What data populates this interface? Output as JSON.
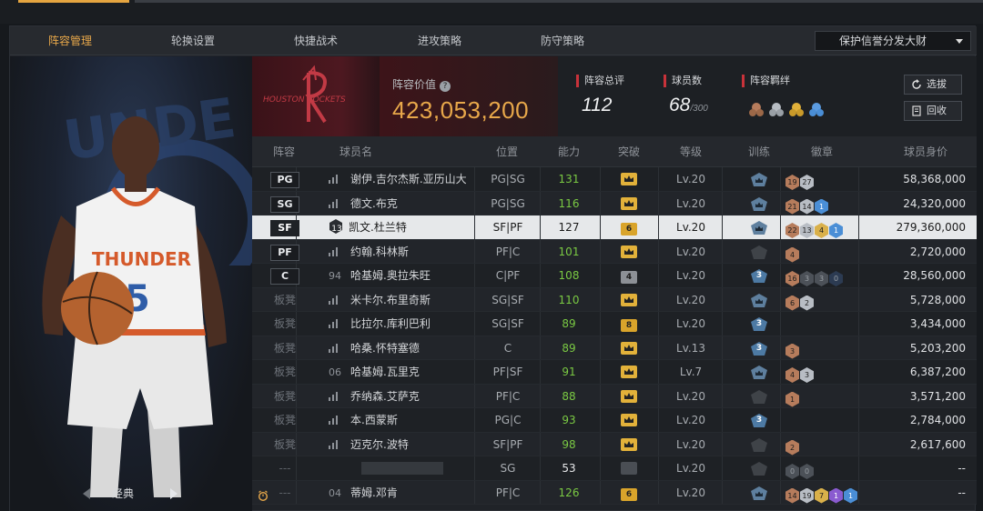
{
  "nav": {
    "tabs": [
      "阵容管理",
      "轮换设置",
      "快捷战术",
      "进攻策略",
      "防守策略"
    ],
    "active_tab": 0,
    "strategy_select": "保护信誉分发大财"
  },
  "left_panel": {
    "classic_label": "经典"
  },
  "team": {
    "logo_text": "HOUSTON ROCKETS",
    "value_label": "阵容价值",
    "value": "423,053,200",
    "rating_label": "阵容总评",
    "rating": "112",
    "players_label": "球员数",
    "players": "68",
    "players_max": "/300",
    "bond_label": "阵容羁绊",
    "select_button": "选拔",
    "recycle_button": "回收",
    "accent_color": "#e8a84a",
    "brand_red": "#c8323a"
  },
  "table": {
    "headers": [
      "阵容",
      "球员名",
      "位置",
      "能力",
      "突破",
      "等级",
      "训练",
      "徽章",
      "球员身价"
    ],
    "rows": [
      {
        "lineup": "PG",
        "lineup_type": "starter",
        "num": "",
        "name": "谢伊.吉尔杰斯.亚历山大",
        "position": "PG|SG",
        "ability": "131",
        "ability_color": "green",
        "breakthrough": "crown",
        "level": "Lv.20",
        "training": "silver",
        "badges": [
          [
            "b-bronze",
            "19"
          ],
          [
            "b-silver",
            "27"
          ]
        ],
        "salary": "58,368,000"
      },
      {
        "lineup": "SG",
        "lineup_type": "starter",
        "num": "",
        "name": "德文.布克",
        "position": "PG|SG",
        "ability": "116",
        "ability_color": "green",
        "breakthrough": "crown",
        "level": "Lv.20",
        "training": "silver",
        "badges": [
          [
            "b-bronze",
            "21"
          ],
          [
            "b-silver",
            "14"
          ],
          [
            "b-blue",
            "1"
          ]
        ],
        "salary": "24,320,000"
      },
      {
        "lineup": "SF",
        "lineup_type": "starter",
        "num": "13",
        "name": "凯文.杜兰特",
        "position": "SF|PF",
        "ability": "127",
        "ability_color": "white",
        "breakthrough": "6",
        "level": "Lv.20",
        "training": "silver",
        "badges": [
          [
            "b-bronze",
            "22"
          ],
          [
            "b-silver",
            "13"
          ],
          [
            "b-gold",
            "4"
          ],
          [
            "b-blue",
            "1"
          ]
        ],
        "salary": "279,360,000",
        "selected": true
      },
      {
        "lineup": "PF",
        "lineup_type": "starter",
        "num": "",
        "name": "约翰.科林斯",
        "position": "PF|C",
        "ability": "101",
        "ability_color": "green",
        "breakthrough": "crown",
        "level": "Lv.20",
        "training": "dark",
        "badges": [
          [
            "b-bronze",
            "4"
          ]
        ],
        "salary": "2,720,000"
      },
      {
        "lineup": "C",
        "lineup_type": "starter",
        "num": "94",
        "name": "哈基姆.奥拉朱旺",
        "position": "C|PF",
        "ability": "108",
        "ability_color": "green",
        "breakthrough": "4",
        "level": "Lv.20",
        "training": "3",
        "badges": [
          [
            "b-bronze",
            "16"
          ],
          [
            "b-dark",
            "3"
          ],
          [
            "b-dark",
            "3"
          ],
          [
            "b-darkblue",
            "0"
          ]
        ],
        "salary": "28,560,000"
      },
      {
        "lineup": "板凳",
        "lineup_type": "bench",
        "num": "",
        "name": "米卡尔.布里奇斯",
        "position": "SG|SF",
        "ability": "110",
        "ability_color": "green",
        "breakthrough": "crown",
        "level": "Lv.20",
        "training": "silver",
        "badges": [
          [
            "b-bronze",
            "6"
          ],
          [
            "b-silver",
            "2"
          ]
        ],
        "salary": "5,728,000"
      },
      {
        "lineup": "板凳",
        "lineup_type": "bench",
        "num": "",
        "name": "比拉尔.库利巴利",
        "position": "SG|SF",
        "ability": "89",
        "ability_color": "green",
        "breakthrough": "8",
        "level": "Lv.20",
        "training": "3",
        "badges": [],
        "salary": "3,434,000"
      },
      {
        "lineup": "板凳",
        "lineup_type": "bench",
        "num": "",
        "name": "哈桑.怀特塞德",
        "position": "C",
        "ability": "89",
        "ability_color": "green",
        "breakthrough": "crown",
        "level": "Lv.13",
        "training": "3",
        "badges": [
          [
            "b-bronze",
            "3"
          ]
        ],
        "salary": "5,203,200"
      },
      {
        "lineup": "板凳",
        "lineup_type": "bench",
        "num": "06",
        "name": "哈基姆.瓦里克",
        "position": "PF|SF",
        "ability": "91",
        "ability_color": "green",
        "breakthrough": "crown",
        "level": "Lv.7",
        "training": "silver",
        "badges": [
          [
            "b-bronze",
            "4"
          ],
          [
            "b-silver",
            "3"
          ]
        ],
        "salary": "6,387,200"
      },
      {
        "lineup": "板凳",
        "lineup_type": "bench",
        "num": "",
        "name": "乔纳森.艾萨克",
        "position": "PF|C",
        "ability": "88",
        "ability_color": "green",
        "breakthrough": "crown",
        "level": "Lv.20",
        "training": "dark",
        "badges": [
          [
            "b-bronze",
            "1"
          ]
        ],
        "salary": "3,571,200"
      },
      {
        "lineup": "板凳",
        "lineup_type": "bench",
        "num": "",
        "name": "本.西蒙斯",
        "position": "PG|C",
        "ability": "93",
        "ability_color": "green",
        "breakthrough": "crown",
        "level": "Lv.20",
        "training": "3",
        "badges": [],
        "salary": "2,784,000"
      },
      {
        "lineup": "板凳",
        "lineup_type": "bench",
        "num": "",
        "name": "迈克尔.波特",
        "position": "SF|PF",
        "ability": "98",
        "ability_color": "green",
        "breakthrough": "crown",
        "level": "Lv.20",
        "training": "dark",
        "badges": [
          [
            "b-bronze",
            "2"
          ]
        ],
        "salary": "2,617,600"
      },
      {
        "lineup": "---",
        "lineup_type": "none",
        "num": "",
        "name": "",
        "position": "SG",
        "ability": "53",
        "ability_color": "white",
        "breakthrough": "dark",
        "level": "Lv.20",
        "training": "dark",
        "badges": [
          [
            "b-dark",
            "0"
          ],
          [
            "b-dark",
            "0"
          ]
        ],
        "salary": "--"
      },
      {
        "lineup": "---",
        "lineup_type": "none",
        "num": "04",
        "name": "蒂姆.邓肯",
        "position": "PF|C",
        "ability": "126",
        "ability_color": "green",
        "breakthrough": "6",
        "level": "Lv.20",
        "training": "silver",
        "badges": [
          [
            "b-bronze",
            "14"
          ],
          [
            "b-silver",
            "19"
          ],
          [
            "b-gold",
            "7"
          ],
          [
            "b-purple",
            "1"
          ],
          [
            "b-blue",
            "1"
          ]
        ],
        "salary": "--",
        "alarm": true
      }
    ]
  }
}
